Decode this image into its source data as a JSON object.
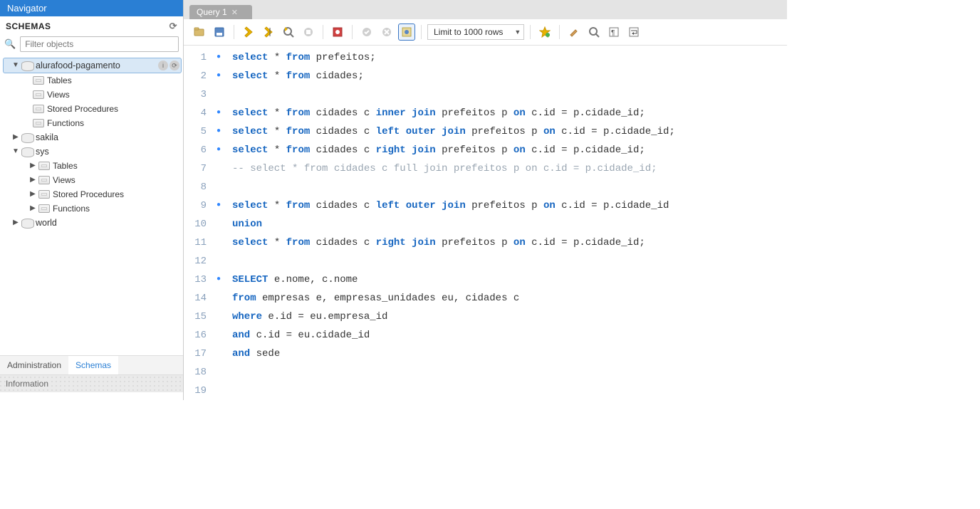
{
  "navigator": {
    "title": "Navigator",
    "schemas_header": "SCHEMAS",
    "filter_placeholder": "Filter objects",
    "bottom_tabs": {
      "admin": "Administration",
      "schemas": "Schemas"
    },
    "info_header": "Information",
    "tree": {
      "db_selected": "alurafood-pagamento",
      "selected_children": {
        "tables": "Tables",
        "views": "Views",
        "sp": "Stored Procedures",
        "fn": "Functions"
      },
      "sakila": "sakila",
      "sys": "sys",
      "sys_children": {
        "tables": "Tables",
        "views": "Views",
        "sp": "Stored Procedures",
        "fn": "Functions"
      },
      "world": "world"
    }
  },
  "editor": {
    "tab_label": "Query 1",
    "limit_label": "Limit to 1000 rows",
    "toolbar_icons": {
      "open": "open-file-icon",
      "save": "save-icon",
      "execute": "execute-icon",
      "execute_script": "execute-script-icon",
      "explain": "explain-icon",
      "stop": "stop-icon",
      "toggle": "toggle-icon",
      "commit": "commit-icon",
      "rollback": "rollback-icon",
      "autocommit": "autocommit-icon",
      "favorite": "favorite-icon",
      "beautify": "beautify-icon",
      "search": "search-icon",
      "invisible": "invisible-chars-icon",
      "wrap": "wrap-icon"
    },
    "lines": [
      {
        "n": 1,
        "dot": true,
        "html": "<span class='kw'>select</span> * <span class='kw'>from</span> prefeitos;"
      },
      {
        "n": 2,
        "dot": true,
        "html": "<span class='kw'>select</span> * <span class='kw'>from</span> cidades;"
      },
      {
        "n": 3,
        "dot": false,
        "html": ""
      },
      {
        "n": 4,
        "dot": true,
        "html": "<span class='kw'>select</span> * <span class='kw'>from</span> cidades c <span class='kw'>inner</span> <span class='kw'>join</span> prefeitos p <span class='kw'>on</span> c.id = p.cidade_id;"
      },
      {
        "n": 5,
        "dot": true,
        "html": "<span class='kw'>select</span> * <span class='kw'>from</span> cidades c <span class='kw'>left</span> <span class='kw'>outer</span> <span class='kw'>join</span> prefeitos p <span class='kw'>on</span> c.id = p.cidade_id;"
      },
      {
        "n": 6,
        "dot": true,
        "html": "<span class='kw'>select</span> * <span class='kw'>from</span> cidades c <span class='kw'>right</span> <span class='kw'>join</span> prefeitos p <span class='kw'>on</span> c.id = p.cidade_id;"
      },
      {
        "n": 7,
        "dot": false,
        "html": "<span class='cm'>-- select * from cidades c full join prefeitos p on c.id = p.cidade_id;</span>"
      },
      {
        "n": 8,
        "dot": false,
        "html": ""
      },
      {
        "n": 9,
        "dot": true,
        "html": "<span class='kw'>select</span> * <span class='kw'>from</span> cidades c <span class='kw'>left</span> <span class='kw'>outer</span> <span class='kw'>join</span> prefeitos p <span class='kw'>on</span> c.id = p.cidade_id"
      },
      {
        "n": 10,
        "dot": false,
        "html": "<span class='kw'>union</span>"
      },
      {
        "n": 11,
        "dot": false,
        "html": "<span class='kw'>select</span> * <span class='kw'>from</span> cidades c <span class='kw'>right</span> <span class='kw'>join</span> prefeitos p <span class='kw'>on</span> c.id = p.cidade_id;"
      },
      {
        "n": 12,
        "dot": false,
        "html": ""
      },
      {
        "n": 13,
        "dot": true,
        "html": "<span class='kw'>SELECT</span> e.nome, c.nome"
      },
      {
        "n": 14,
        "dot": false,
        "html": "<span class='kw'>from</span> empresas e, empresas_unidades eu, cidades c"
      },
      {
        "n": 15,
        "dot": false,
        "html": "<span class='kw'>where</span> e.id = eu.empresa_id"
      },
      {
        "n": 16,
        "dot": false,
        "html": "<span class='kw'>and</span> c.id = eu.cidade_id"
      },
      {
        "n": 17,
        "dot": false,
        "html": "<span class='kw'>and</span> sede"
      },
      {
        "n": 18,
        "dot": false,
        "html": ""
      },
      {
        "n": 19,
        "dot": false,
        "html": ""
      }
    ]
  }
}
